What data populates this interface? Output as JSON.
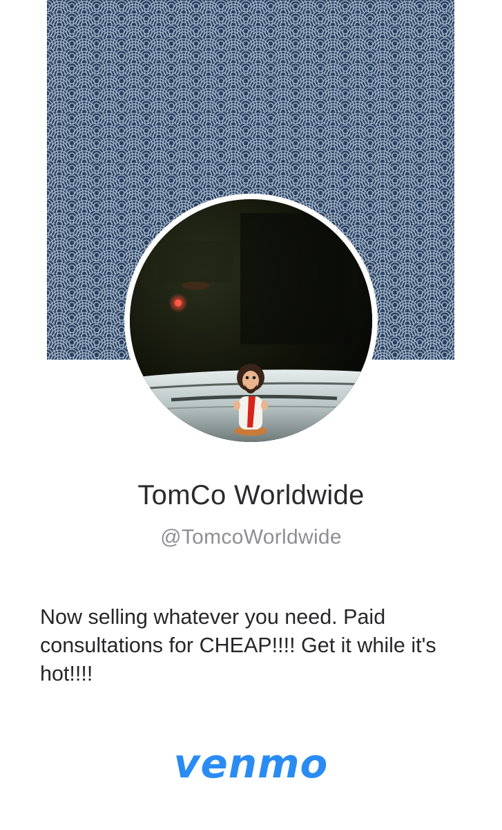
{
  "profile": {
    "display_name": "TomCo Worldwide",
    "username": "@TomcoWorldwide",
    "bio": "Now selling whatever you need. Paid consultations for CHEAP!!!! Get it while it's hot!!!!"
  },
  "brand": {
    "logo_text": "venmo",
    "color": "#2a8cf2"
  },
  "cover": {
    "pattern": "seigaiha-waves",
    "background_color": "#2b4060",
    "line_color": "#9fb3c8"
  },
  "avatar": {
    "subject": "bobblehead figurine on car dashboard"
  }
}
